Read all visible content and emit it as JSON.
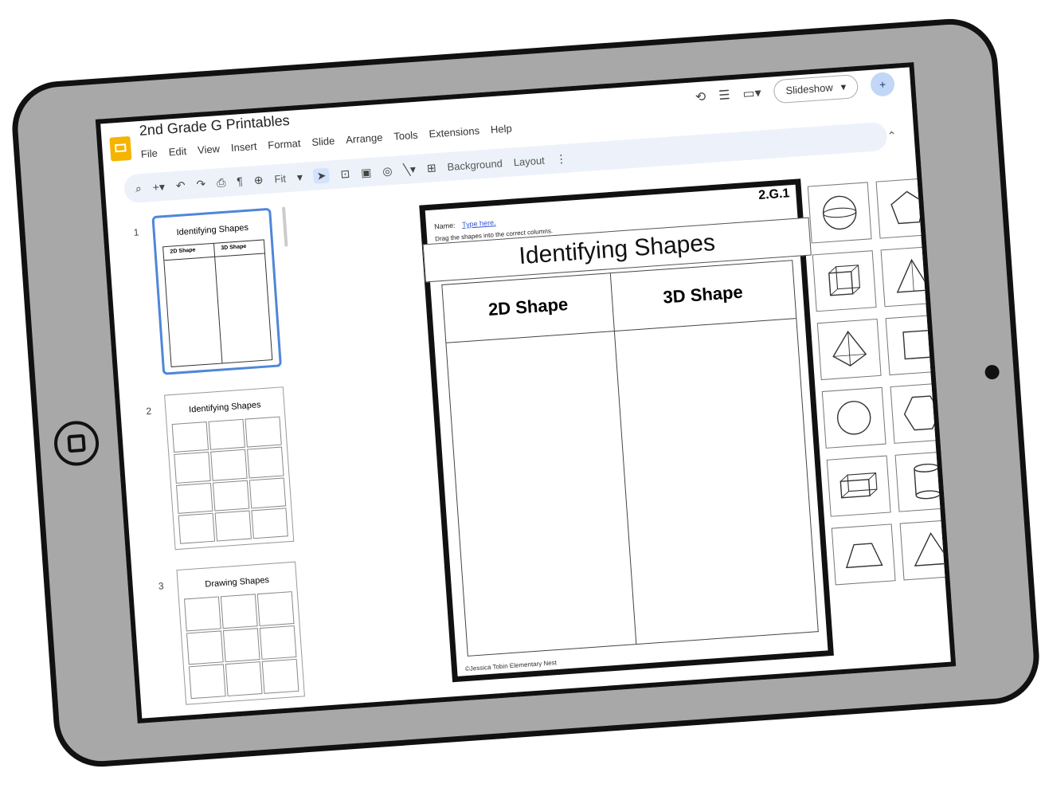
{
  "app": {
    "doc_title": "2nd Grade G Printables",
    "menu": [
      "File",
      "Edit",
      "View",
      "Insert",
      "Format",
      "Slide",
      "Arrange",
      "Tools",
      "Extensions",
      "Help"
    ],
    "slideshow_label": "Slideshow",
    "zoom": "Fit",
    "toolbar_background": "Background",
    "toolbar_layout": "Layout"
  },
  "filmstrip": [
    {
      "num": "1",
      "title": "Identifying Shapes",
      "col1": "2D Shape",
      "col2": "3D Shape"
    },
    {
      "num": "2",
      "title": "Identifying Shapes"
    },
    {
      "num": "3",
      "title": "Drawing Shapes"
    }
  ],
  "slide": {
    "standard": "2.G.1",
    "name_label": "Name:",
    "name_placeholder": "Type here.",
    "instructions": "Drag the shapes into the correct columns.",
    "title": "Identifying Shapes",
    "col1": "2D Shape",
    "col2": "3D Shape",
    "copyright": "©Jessica Tobin Elementary Nest"
  },
  "shape_icons": [
    "sphere",
    "pentagon",
    "cube",
    "triangle-pyramid",
    "square-pyramid",
    "square",
    "circle",
    "hexagon",
    "rectangular-prism",
    "cylinder",
    "trapezoid",
    "triangle"
  ],
  "colors": {
    "tablet_body": "#a8a8a8",
    "accent": "#4f86d9",
    "logo": "#f4b400"
  }
}
